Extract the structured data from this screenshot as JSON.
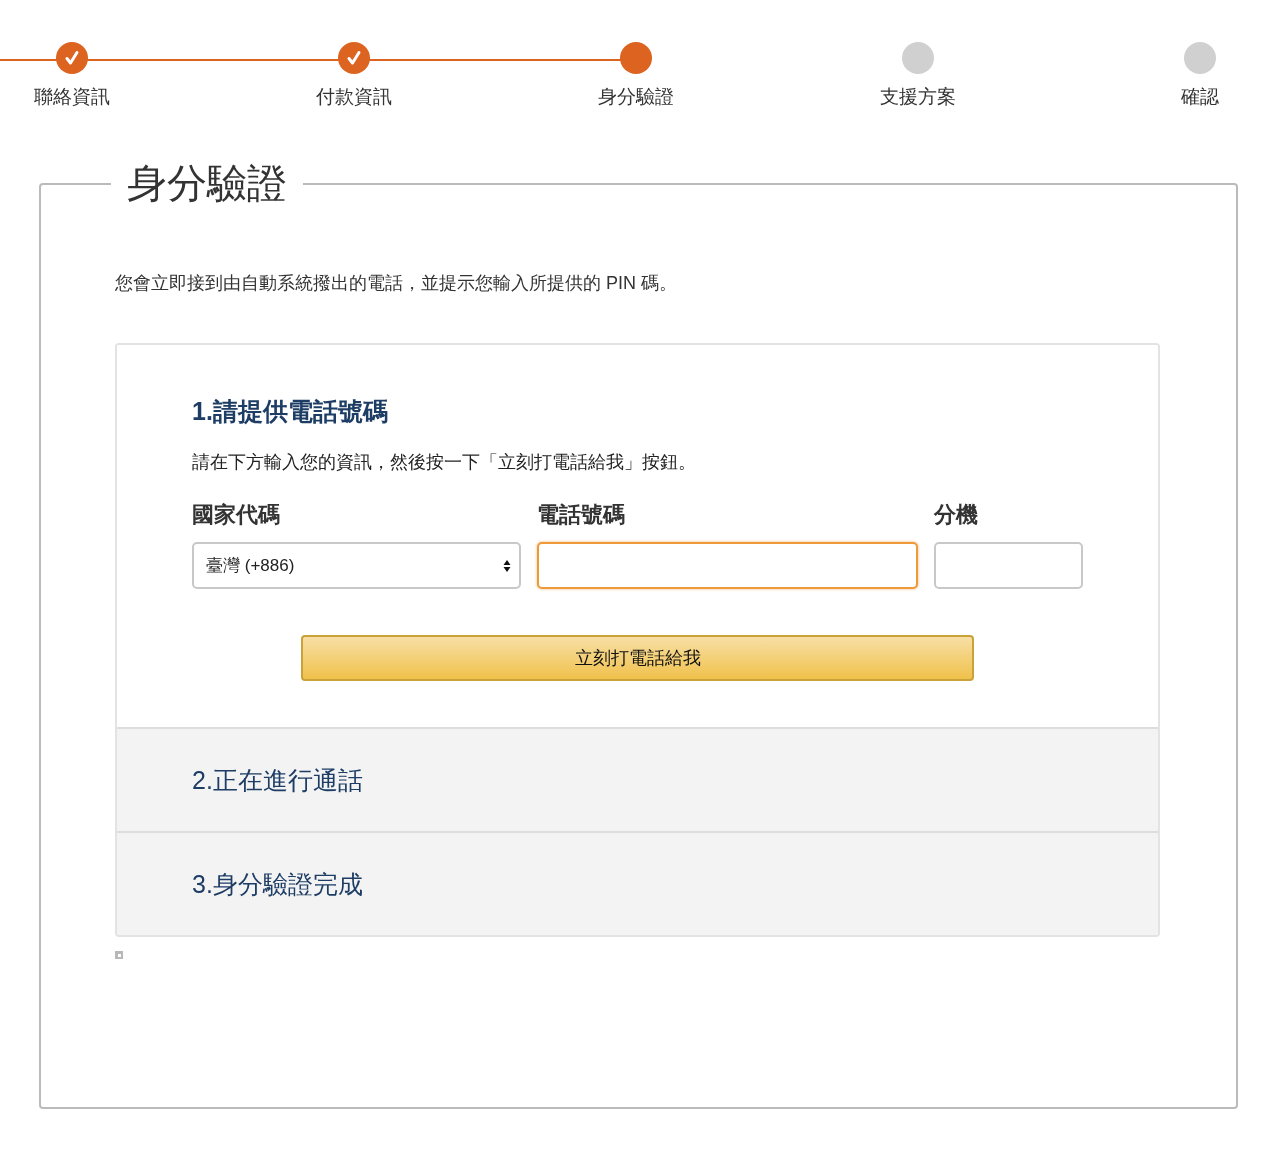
{
  "progress_steps": [
    {
      "label": "聯絡資訊",
      "kind": "done"
    },
    {
      "label": "付款資訊",
      "kind": "done"
    },
    {
      "label": "身分驗證",
      "kind": "current"
    },
    {
      "label": "支援方案",
      "kind": "pending"
    },
    {
      "label": "確認",
      "kind": "pending"
    }
  ],
  "page_title": "身分驗證",
  "description": "您會立即接到由自動系統撥出的電話，並提示您輸入所提供的 PIN 碼。",
  "sections": [
    {
      "title": "1.請提供電話號碼",
      "expanded": true,
      "instruction": "請在下方輸入您的資訊，然後按一下「立刻打電話給我」按鈕。",
      "fields": [
        {
          "kind": "select",
          "label": "國家代碼",
          "value": "臺灣 (+886)",
          "focused": false
        },
        {
          "kind": "text",
          "label": "電話號碼",
          "focused": true
        },
        {
          "kind": "text",
          "label": "分機",
          "focused": false
        }
      ],
      "button": "立刻打電話給我"
    },
    {
      "title": "2.正在進行通話",
      "expanded": false
    },
    {
      "title": "3.身分驗證完成",
      "expanded": false
    }
  ]
}
